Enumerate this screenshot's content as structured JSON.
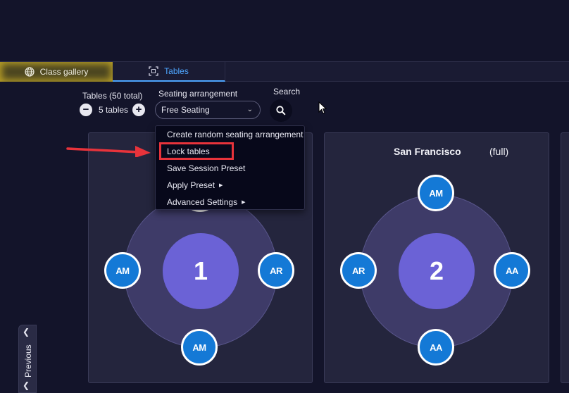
{
  "tabs": {
    "gallery_label": "Class gallery",
    "tables_label": "Tables"
  },
  "controls": {
    "tables_label": "Tables (50 total)",
    "tables_count": "5 tables",
    "minus": "−",
    "plus": "+",
    "seating_label": "Seating arrangement",
    "seating_value": "Free Seating",
    "search_label": "Search"
  },
  "menu": {
    "items": [
      "Create random seating arrangement",
      "Lock tables",
      "Save Session Preset",
      "Apply Preset",
      "Advanced Settings"
    ]
  },
  "cards": [
    {
      "number": "1",
      "seats": {
        "left": "AM",
        "right": "AR",
        "bottom": "AM"
      }
    },
    {
      "title": "San Francisco",
      "status": "(full)",
      "number": "2",
      "seats": {
        "top": "AM",
        "left": "AR",
        "right": "AA",
        "bottom": "AA"
      }
    }
  ],
  "nav": {
    "previous_label": "Previous"
  },
  "colors": {
    "accent_blue": "#4ea6ff",
    "seat_blue": "#1479d6",
    "hub_purple": "#6b62d6",
    "highlight_red": "#e8333b"
  }
}
